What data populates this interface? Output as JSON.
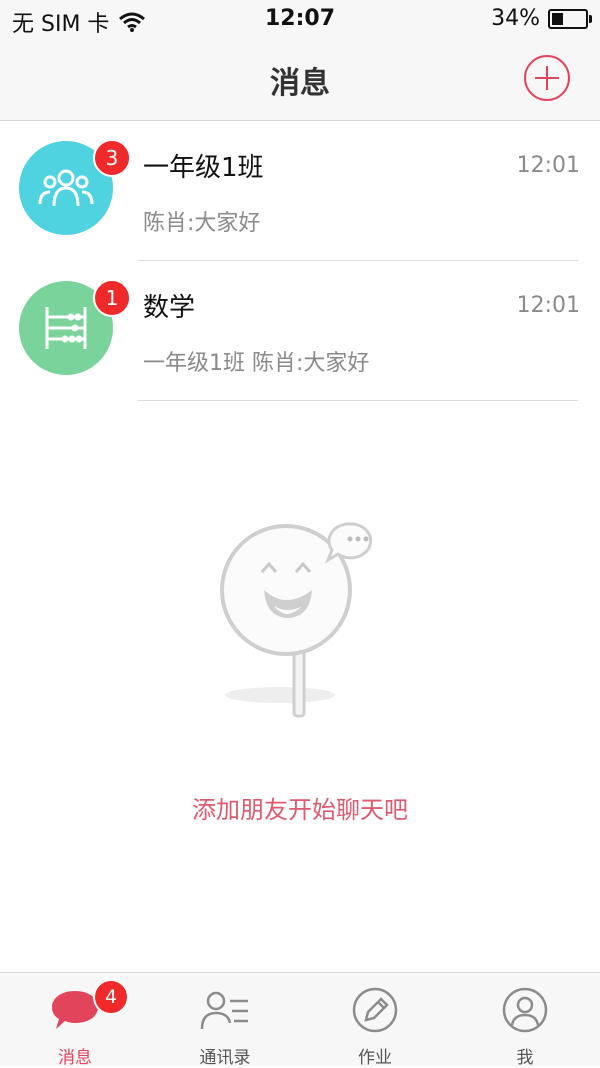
{
  "status_bar": {
    "carrier": "无 SIM 卡",
    "time": "12:07",
    "battery_text": "34%",
    "battery_level": 0.34
  },
  "nav": {
    "title": "消息"
  },
  "conversations": [
    {
      "title": "一年级1班",
      "preview": "陈肖:大家好",
      "time": "12:01",
      "badge": "3",
      "avatar_color": "#4fd3e0",
      "icon": "group-icon"
    },
    {
      "title": "数学",
      "preview": "一年级1班 陈肖:大家好",
      "time": "12:01",
      "badge": "1",
      "avatar_color": "#79d39b",
      "icon": "abacus-icon"
    }
  ],
  "empty_state": {
    "message": "添加朋友开始聊天吧"
  },
  "tabbar": {
    "tabs": [
      {
        "label": "消息",
        "icon": "chat-bubble-icon",
        "badge": "4",
        "active": true
      },
      {
        "label": "通讯录",
        "icon": "contacts-icon"
      },
      {
        "label": "作业",
        "icon": "pencil-icon"
      },
      {
        "label": "我",
        "icon": "profile-icon"
      }
    ]
  },
  "colors": {
    "accent": "#e2445c",
    "badge": "#f02a2a"
  }
}
